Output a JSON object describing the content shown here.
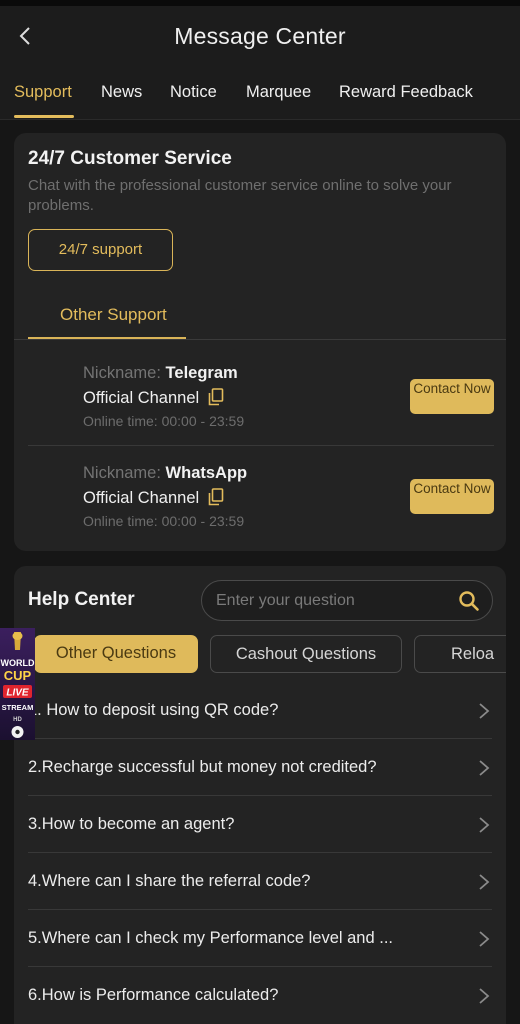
{
  "header": {
    "title": "Message Center",
    "back_icon": "chevron-left-icon"
  },
  "tabs": [
    {
      "label": "Support",
      "active": true
    },
    {
      "label": "News"
    },
    {
      "label": "Notice"
    },
    {
      "label": "Marquee"
    },
    {
      "label": "Reward Feedback"
    }
  ],
  "customer_service": {
    "title": "24/7 Customer Service",
    "description": "Chat with the professional customer service online to solve your problems.",
    "support_button": "24/7 support",
    "other_support_tab": "Other Support",
    "contacts": [
      {
        "nickname_label": "Nickname:",
        "nickname": "Telegram",
        "channel": "Official Channel",
        "online_label": "Online time:",
        "online_time": "00:00 - 23:59",
        "button": "Contact Now"
      },
      {
        "nickname_label": "Nickname:",
        "nickname": "WhatsApp",
        "channel": "Official Channel",
        "online_label": "Online time:",
        "online_time": "00:00 - 23:59",
        "button": "Contact Now"
      }
    ]
  },
  "help_center": {
    "title": "Help Center",
    "search_placeholder": "Enter your question",
    "question_tabs": [
      "Other Questions",
      "Cashout Questions",
      "Reloa"
    ],
    "questions": [
      "1. How to deposit using QR code?",
      "2.Recharge successful but money not credited?",
      "3.How to become an agent?",
      "4.Where can I share the referral code?",
      "5.Where can I check my Performance level and ...",
      "6.How is Performance calculated?"
    ]
  },
  "promo_badge": {
    "lines": [
      "WORLD",
      "CUP",
      "LIVE",
      "STREAM",
      "HD"
    ]
  },
  "colors": {
    "accent": "#e3bc5c",
    "background": "#161616",
    "card": "#232323"
  }
}
